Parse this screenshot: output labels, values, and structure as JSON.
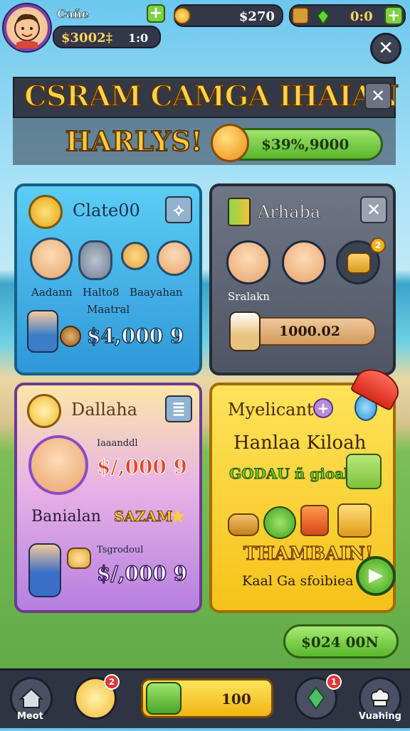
{
  "colors": {
    "accent_green": "#58b52d",
    "gold": "#ffcb3a",
    "panel_dark": "#343947"
  },
  "topbar": {
    "player_name": "Cañe",
    "player_money": "$3002‡",
    "player_level": "1:0",
    "coins": "$270",
    "gems": "0:0",
    "icons": [
      "avatar",
      "coin-icon",
      "gem-icon",
      "plus-icon"
    ]
  },
  "header": {
    "title": "CSRAM CAMGA IHAIAN",
    "subtitle": "HARLYS!",
    "progress_value": "$39%,9000"
  },
  "card1": {
    "title": "Clate00",
    "members": [
      {
        "name": "Aadann"
      },
      {
        "name": "Halto8"
      },
      {
        "name": "Baayahan"
      }
    ],
    "extra_label": "Maatral",
    "amount": "$4,000 9"
  },
  "card2": {
    "title": "Arhaba",
    "label": "Sralakn",
    "badge": "2",
    "bar_value": "1000.02"
  },
  "card3": {
    "title": "Dallaha",
    "small_label": "Iaaanddl",
    "amount1": "$/,000 9",
    "row_label": "Banialan",
    "row_value": "SAZAM",
    "small_label2": "Tsgrodoul",
    "amount2": "$/,000 9"
  },
  "card4": {
    "title": "Myelicant",
    "heading": "Hanlaa Kiloah",
    "green_text": "GODAU ñ gioab",
    "promo": "THAMBAIN!",
    "footer": "Kaal Ga sfoibiea"
  },
  "bottom_button": "$024 00N",
  "nav": {
    "items": [
      {
        "label": "Meot",
        "badge": ""
      },
      {
        "label": "",
        "badge": "2"
      },
      {
        "label": "",
        "value": "100",
        "badge": ""
      },
      {
        "label": "",
        "badge": "1"
      },
      {
        "label": "Vuahing",
        "badge": ""
      }
    ]
  }
}
